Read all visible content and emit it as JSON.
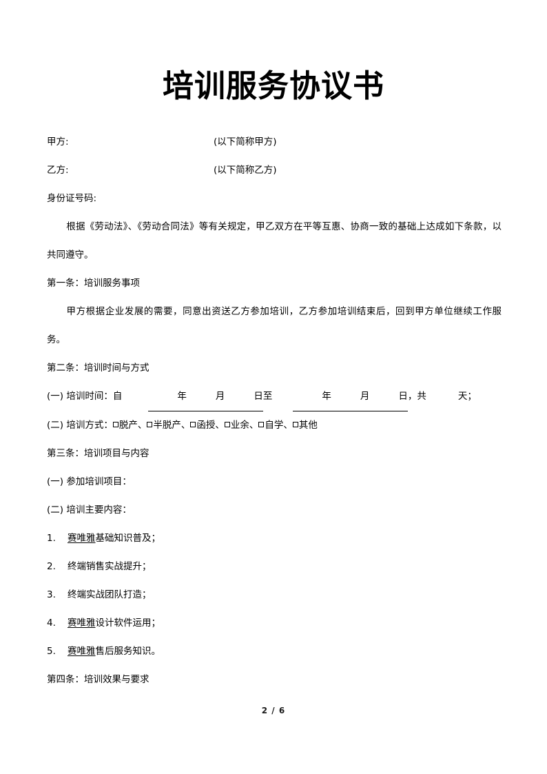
{
  "document": {
    "title": "培训服务协议书",
    "page_footer": "2 / 6"
  },
  "parties": {
    "party_a_label": "甲方:",
    "party_a_note": "(以下简称甲方)",
    "party_b_label": "乙方:",
    "party_b_note": "(以下简称乙方)",
    "id_number_label": "身份证号码:"
  },
  "preamble": {
    "text": "根据《劳动法》、《劳动合同法》等有关规定，甲乙双方在平等互惠、协商一致的基础上达成如下条款，以共同遵守。"
  },
  "clause_1": {
    "heading": "第一条：培训服务事项",
    "body": "甲方根据企业发展的需要，同意出资送乙方参加培训，乙方参加培训结束后，回到甲方单位继续工作服务。"
  },
  "clause_2": {
    "heading": "第二条：培训时间与方式",
    "item_1_prefix": "(一) 培训时间：自",
    "year_label": "年",
    "month_label": "月",
    "day_label": "日",
    "to_label": "至",
    "comma_total": "，共",
    "days_label": "天；",
    "item_2_prefix": "(二) 培训方式：",
    "methods": [
      "脱产",
      "半脱产",
      "函授",
      "业余",
      "自学",
      "其他"
    ],
    "method_separator": "、"
  },
  "clause_3": {
    "heading": "第三条：培训项目与内容",
    "item_1": "(一) 参加培训项目：",
    "item_2": "(二) 培训主要内容：",
    "list": [
      {
        "number": "1.",
        "underlined": "赛唯雅",
        "rest": "基础知识普及；"
      },
      {
        "number": "2.",
        "underlined": "",
        "rest": "终端销售实战提升；"
      },
      {
        "number": "3.",
        "underlined": "",
        "rest": "终端实战团队打造；"
      },
      {
        "number": "4.",
        "underlined": "赛唯雅",
        "rest": "设计软件运用；"
      },
      {
        "number": "5.",
        "underlined": "赛唯雅",
        "rest": "售后服务知识。"
      }
    ]
  },
  "clause_4": {
    "heading": "第四条：培训效果与要求"
  }
}
